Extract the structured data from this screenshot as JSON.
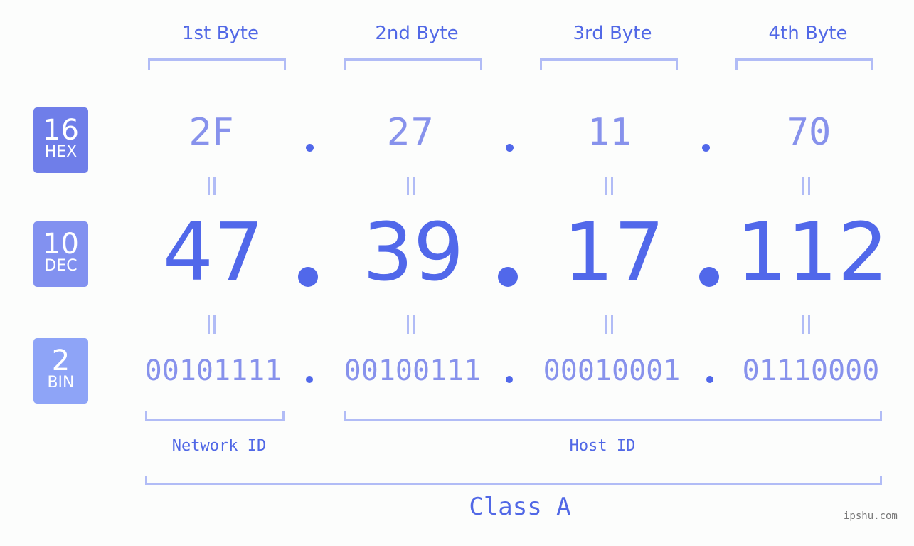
{
  "headers": [
    "1st Byte",
    "2nd Byte",
    "3rd Byte",
    "4th Byte"
  ],
  "rows": {
    "hex": {
      "base": "16",
      "label": "HEX",
      "values": [
        "2F",
        "27",
        "11",
        "70"
      ],
      "badge_color": "#6f7ee9"
    },
    "dec": {
      "base": "10",
      "label": "DEC",
      "values": [
        "47",
        "39",
        "17",
        "112"
      ],
      "badge_color": "#8291f0"
    },
    "bin": {
      "base": "2",
      "label": "BIN",
      "values": [
        "00101111",
        "00100111",
        "00010001",
        "01110000"
      ],
      "badge_color": "#8ea4f7"
    }
  },
  "separator": ".",
  "equals_glyph": "=",
  "network_id_label": "Network ID",
  "host_id_label": "Host ID",
  "class_label": "Class A",
  "watermark": "ipshu.com",
  "colors": {
    "accent": "#5168ea",
    "light_value": "#8792ec",
    "bracket": "#b1bcf6",
    "background": "#fcfdfc"
  }
}
